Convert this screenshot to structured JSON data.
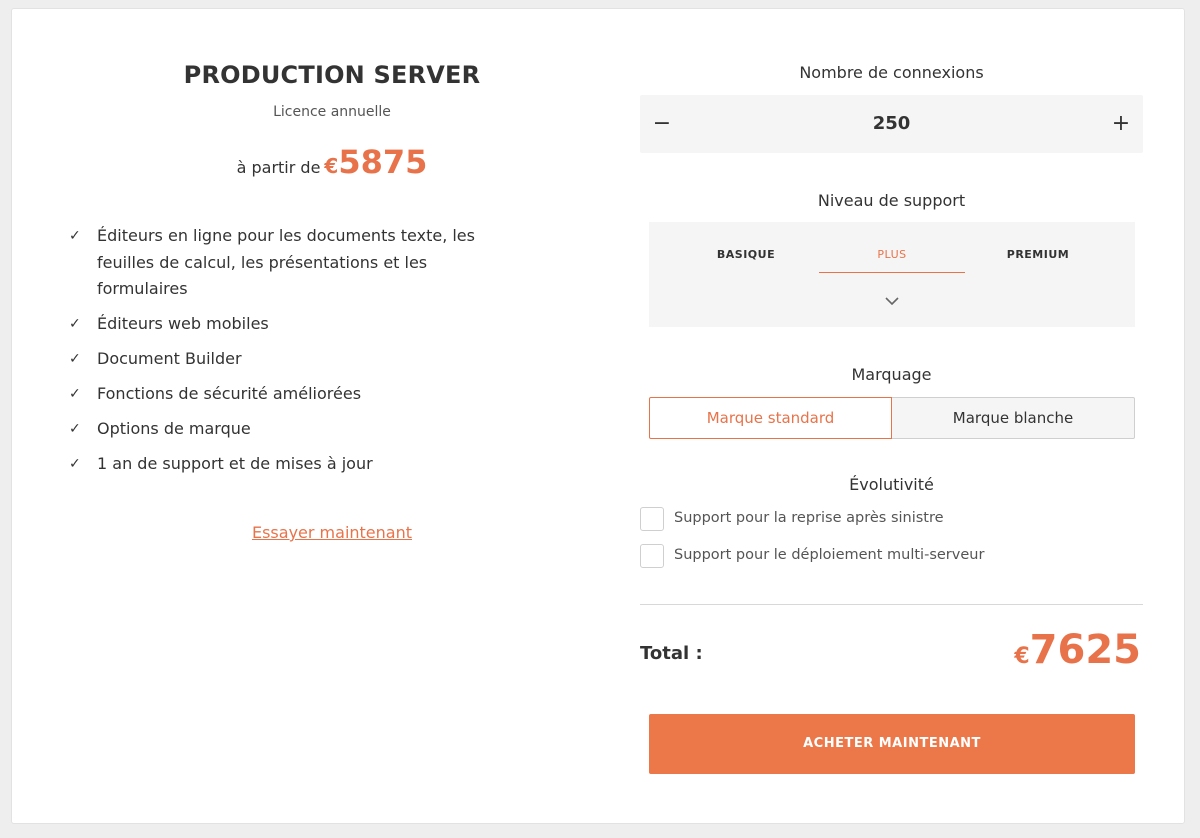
{
  "product": {
    "title": "PRODUCTION SERVER",
    "subtitle": "Licence annuelle",
    "price_prefix": "à partir de",
    "currency": "€",
    "price": "5875"
  },
  "features": [
    "Éditeurs en ligne pour les documents texte, les feuilles de calcul, les présentations et les formulaires",
    "Éditeurs web mobiles",
    "Document Builder",
    "Fonctions de sécurité améliorées",
    "Options de marque",
    "1 an de support et de mises à jour"
  ],
  "try_link": "Essayer maintenant",
  "connections": {
    "label": "Nombre de connexions",
    "minus": "−",
    "plus": "+",
    "value": "250"
  },
  "support": {
    "label": "Niveau de support",
    "options": [
      "BASIQUE",
      "PLUS",
      "PREMIUM"
    ],
    "selected": "PLUS",
    "chevron_icon": "chevron-down-icon"
  },
  "branding": {
    "label": "Marquage",
    "options": [
      "Marque standard",
      "Marque blanche"
    ],
    "selected": "Marque standard"
  },
  "scalability": {
    "label": "Évolutivité",
    "options": [
      {
        "label": "Support pour la reprise après sinistre",
        "checked": false
      },
      {
        "label": "Support pour le déploiement multi-serveur",
        "checked": false
      }
    ]
  },
  "total": {
    "label": "Total :",
    "currency": "€",
    "amount": "7625"
  },
  "buy_button": "ACHETER MAINTENANT",
  "colors": {
    "accent": "#e8734a",
    "button": "#ec7749",
    "panel": "#f5f5f5"
  }
}
